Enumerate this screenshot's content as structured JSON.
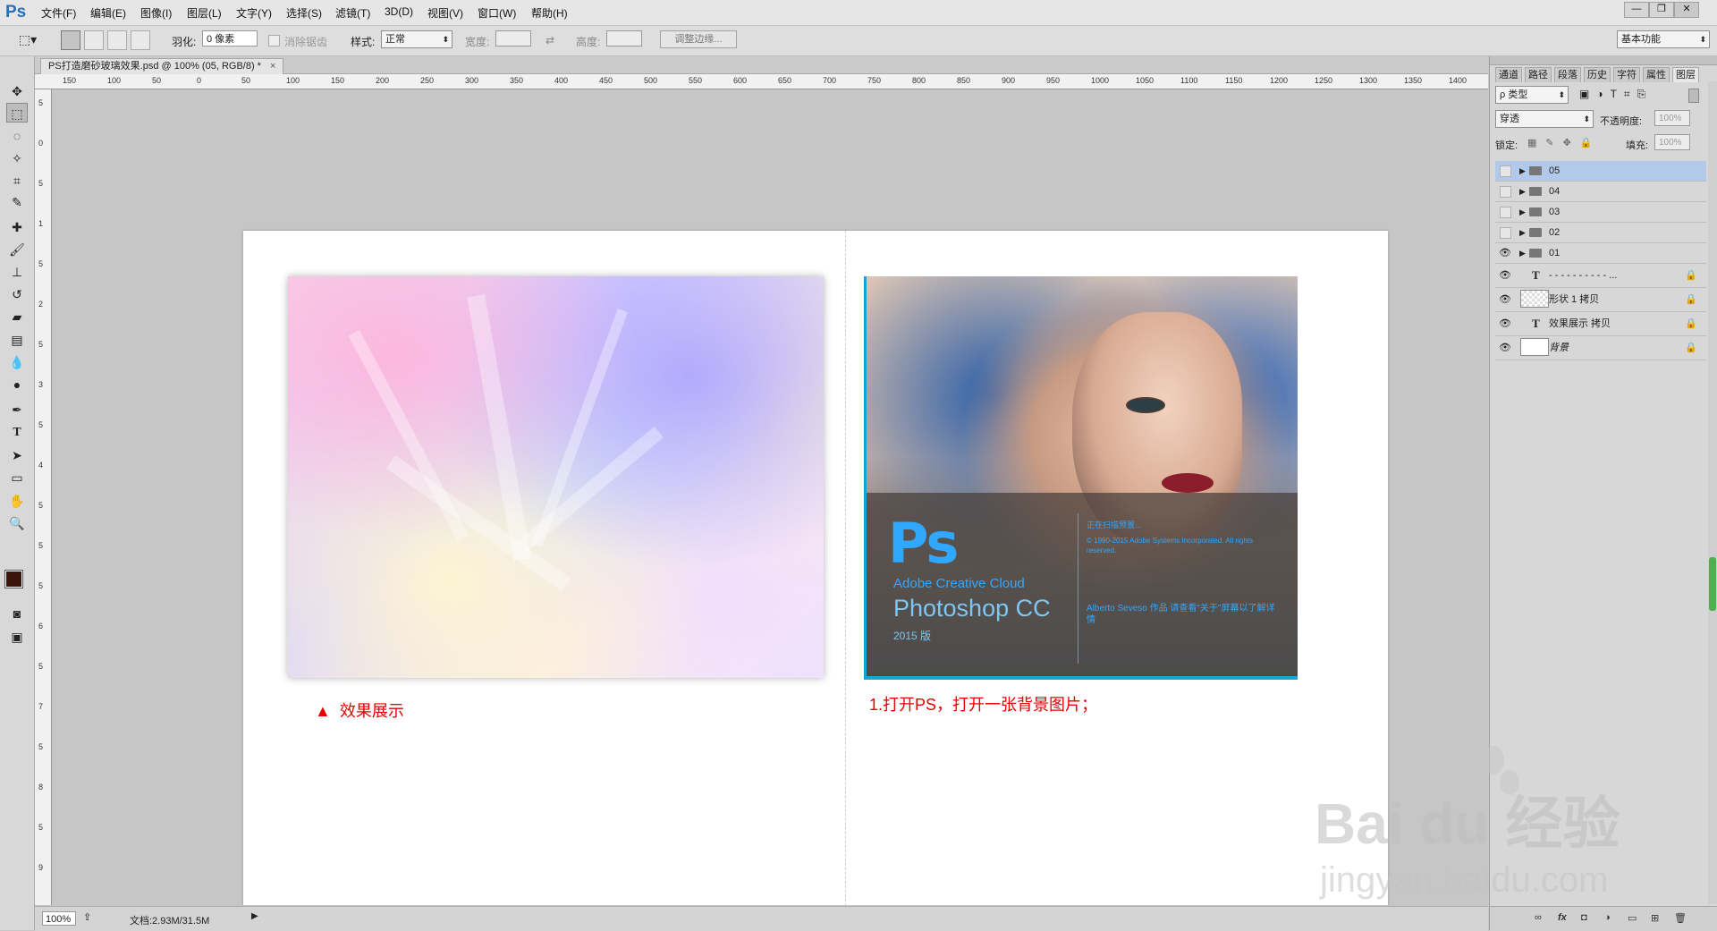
{
  "app": {
    "logo": "Ps",
    "menus": [
      "文件(F)",
      "编辑(E)",
      "图像(I)",
      "图层(L)",
      "文字(Y)",
      "选择(S)",
      "滤镜(T)",
      "3D(D)",
      "视图(V)",
      "窗口(W)",
      "帮助(H)"
    ],
    "window_buttons": {
      "minimize": "—",
      "restore": "❐",
      "close": "✕"
    }
  },
  "options": {
    "feather_label": "羽化:",
    "feather_value": "0 像素",
    "antialias_label": "消除锯齿",
    "style_label": "样式:",
    "style_value": "正常",
    "width_label": "宽度:",
    "height_label": "高度:",
    "refine_edge": "调整边缘...",
    "workspace": "基本功能"
  },
  "document": {
    "tab_title": "PS打造磨砂玻璃效果.psd @ 100% (05, RGB/8) *",
    "tab_close": "×",
    "effect_caption": "效果展示",
    "effect_marker": "▲",
    "step_caption": "1.打开PS，打开一张背景图片；",
    "splash": {
      "logo": "Ps",
      "product_line": "Adobe Creative Cloud",
      "product": "Photoshop CC",
      "version": "2015 版",
      "loading": "正在扫描预置...",
      "copyright": "© 1990-2015 Adobe Systems Incorporated. All rights reserved.",
      "artist": "Alberto Seveso 作品 请查看\"关于\"屏幕以了解详情"
    }
  },
  "ruler": {
    "top_ticks": [
      "150",
      "100",
      "50",
      "0",
      "50",
      "100",
      "150",
      "200",
      "250",
      "300",
      "350",
      "400",
      "450",
      "500",
      "550",
      "600",
      "650",
      "700",
      "750",
      "800",
      "850",
      "900",
      "950",
      "1000",
      "1050",
      "1100",
      "1150",
      "1200",
      "1250",
      "1300",
      "1350",
      "1400"
    ],
    "left_ticks": [
      "5",
      "0",
      "5",
      "1",
      "5",
      "2",
      "5",
      "3",
      "5",
      "4",
      "5",
      "5",
      "5",
      "6",
      "5",
      "7",
      "5",
      "8",
      "5",
      "9"
    ]
  },
  "status": {
    "zoom": "100%",
    "doc_info": "文档:2.93M/31.5M",
    "arrow": "▶"
  },
  "panel": {
    "tabs": [
      "通道",
      "路径",
      "段落",
      "历史",
      "字符",
      "属性",
      "图层"
    ],
    "filter_kind": "ρ 类型",
    "blend_mode": "穿透",
    "opacity_label": "不透明度:",
    "opacity_value": "100%",
    "lock_label": "锁定:",
    "fill_label": "填充:",
    "fill_value": "100%",
    "layers": [
      {
        "name": "05",
        "type": "group",
        "visible": false,
        "selected": true
      },
      {
        "name": "04",
        "type": "group",
        "visible": false,
        "selected": false
      },
      {
        "name": "03",
        "type": "group",
        "visible": false,
        "selected": false
      },
      {
        "name": "02",
        "type": "group",
        "visible": false,
        "selected": false
      },
      {
        "name": "01",
        "type": "group",
        "visible": true,
        "selected": false
      },
      {
        "name": "- - - - - - - - - - ...",
        "type": "text",
        "visible": true,
        "locked": true
      },
      {
        "name": "形状 1 拷贝",
        "type": "shape",
        "visible": true,
        "locked": true
      },
      {
        "name": "效果展示 拷贝",
        "type": "text",
        "visible": true,
        "locked": true
      },
      {
        "name": "背景",
        "type": "background",
        "visible": true,
        "locked": true
      }
    ],
    "bottom_icons": [
      "link-icon",
      "fx-icon",
      "mask-icon",
      "adjustment-icon",
      "folder-icon",
      "new-layer-icon",
      "trash-icon"
    ],
    "bottom_glyphs": [
      "∞",
      "fx",
      "◘",
      "◑",
      "▭",
      "⊞",
      "🗑"
    ]
  },
  "watermark": {
    "brand": "Bai du 经验",
    "url": "jingyan.baidu.com"
  },
  "colors": {
    "accent_blue": "#31a8ff",
    "caption_red": "#e60000",
    "selection_blue": "#b3c9e9"
  }
}
